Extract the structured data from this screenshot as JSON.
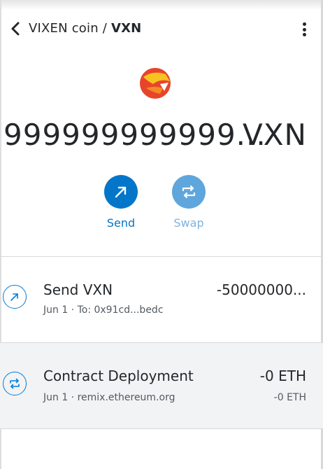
{
  "header": {
    "token_name": "VIXEN coin",
    "separator": " / ",
    "token_symbol": "VXN"
  },
  "balance": {
    "amount": "999999999999...",
    "symbol": "VXN"
  },
  "actions": {
    "send_label": "Send",
    "swap_label": "Swap"
  },
  "transactions": [
    {
      "title": "Send VXN",
      "subtitle": "Jun 1 · To: 0x91cd...bedc",
      "amount": "-50000000...",
      "fiat": "",
      "icon": "arrow-up-right-icon",
      "status_color": "#037dd6"
    },
    {
      "title": "Contract Deployment",
      "subtitle": "Jun 1 · remix.ethereum.org",
      "amount": "-0 ETH",
      "fiat": "-0 ETH",
      "icon": "swap-arrows-icon",
      "status_color": "#037dd6"
    }
  ],
  "colors": {
    "primary": "#0376c9",
    "primary_disabled": "#5fa6dc",
    "text": "#24272a",
    "muted_text": "#535a61",
    "row_highlight": "#f2f3f4"
  }
}
